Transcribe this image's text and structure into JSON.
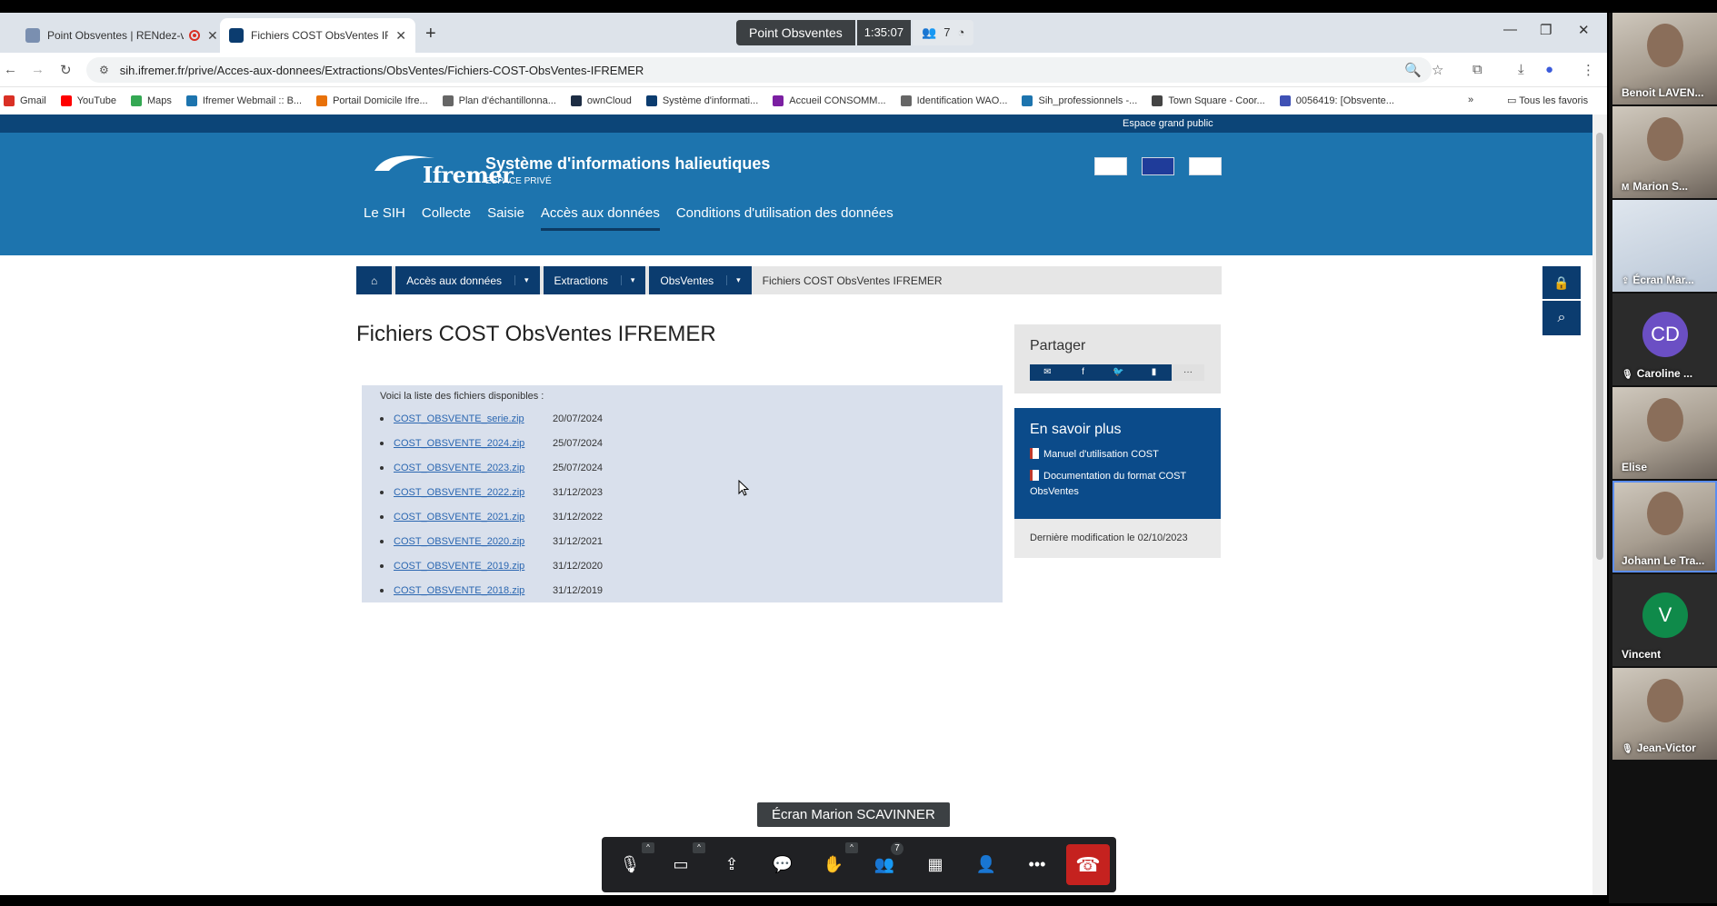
{
  "browser": {
    "tabs": [
      {
        "title": "Point Obsventes | RENdez-vous",
        "active": false
      },
      {
        "title": "Fichiers COST ObsVentes IFREMER",
        "active": true
      }
    ],
    "url": "sih.ifremer.fr/prive/Acces-aux-donnees/Extractions/ObsVentes/Fichiers-COST-ObsVentes-IFREMER",
    "bookmarks": [
      {
        "label": "Gmail",
        "color": "#d93025"
      },
      {
        "label": "YouTube",
        "color": "#ff0000"
      },
      {
        "label": "Maps",
        "color": "#34a853"
      },
      {
        "label": "Ifremer Webmail :: B...",
        "color": "#1d74ae"
      },
      {
        "label": "Portail Domicile Ifre...",
        "color": "#e8710a"
      },
      {
        "label": "Plan d'échantillonna...",
        "color": "#666666"
      },
      {
        "label": "ownCloud",
        "color": "#1d2d44"
      },
      {
        "label": "Système d'informati...",
        "color": "#0b3c6f"
      },
      {
        "label": "Accueil CONSOMM...",
        "color": "#7b1fa2"
      },
      {
        "label": "Identification WAO...",
        "color": "#666666"
      },
      {
        "label": "Sih_professionnels -...",
        "color": "#1d74ae"
      },
      {
        "label": "Town Square - Coor...",
        "color": "#444444"
      },
      {
        "label": "0056419: [Obsvente...",
        "color": "#3f51b5"
      }
    ],
    "bookmarks_more": "»",
    "all_bookmarks": "Tous les favoris"
  },
  "meeting": {
    "title": "Point Obsventes",
    "timer": "1:35:07",
    "participant_count": "7",
    "screen_label": "Écran Marion SCAVINNER",
    "people_badge": "7",
    "participants": [
      {
        "name": "Benoit LAVEN...",
        "type": "video"
      },
      {
        "name": "Marion S...",
        "type": "video",
        "badge": "M"
      },
      {
        "name": "Écran Mar...",
        "type": "screen"
      },
      {
        "name": "Caroline ...",
        "type": "avatar",
        "initials": "CD",
        "color": "#6b4fc4",
        "muted": true
      },
      {
        "name": "Elise",
        "type": "video"
      },
      {
        "name": "Johann Le Tra...",
        "type": "video",
        "active": true
      },
      {
        "name": "Vincent",
        "type": "avatar",
        "initials": "V",
        "color": "#0f8a4a"
      },
      {
        "name": "Jean-Victor",
        "type": "video",
        "muted": true
      }
    ]
  },
  "site": {
    "top_link": "Espace grand public",
    "logo_text": "Ifremer",
    "title": "Système d'informations halieutiques",
    "subtitle": "ESPACE PRIVÉ",
    "nav": [
      "Le SIH",
      "Collecte",
      "Saisie",
      "Accès aux données",
      "Conditions d'utilisation des données"
    ],
    "nav_active": "Accès aux données",
    "breadcrumb": [
      "Accès aux données",
      "Extractions",
      "ObsVentes"
    ],
    "breadcrumb_current": "Fichiers COST ObsVentes IFREMER",
    "page_title": "Fichiers COST ObsVentes IFREMER",
    "files_intro": "Voici la liste des fichiers disponibles :",
    "files": [
      {
        "name": "COST_OBSVENTE_serie.zip",
        "date": "20/07/2024"
      },
      {
        "name": "COST_OBSVENTE_2024.zip",
        "date": "25/07/2024"
      },
      {
        "name": "COST_OBSVENTE_2023.zip",
        "date": "25/07/2024"
      },
      {
        "name": "COST_OBSVENTE_2022.zip",
        "date": "31/12/2023"
      },
      {
        "name": "COST_OBSVENTE_2021.zip",
        "date": "31/12/2022"
      },
      {
        "name": "COST_OBSVENTE_2020.zip",
        "date": "31/12/2021"
      },
      {
        "name": "COST_OBSVENTE_2019.zip",
        "date": "31/12/2020"
      },
      {
        "name": "COST_OBSVENTE_2018.zip",
        "date": "31/12/2019"
      }
    ],
    "share_title": "Partager",
    "share_icons": [
      "envelope-icon",
      "facebook-icon",
      "twitter-icon",
      "bookmark-icon",
      "more-icon"
    ],
    "more_title": "En savoir plus",
    "more_links": [
      "Manuel d'utilisation COST",
      "Documentation du format COST ObsVentes"
    ],
    "last_modified": "Dernière modification le 02/10/2023"
  }
}
